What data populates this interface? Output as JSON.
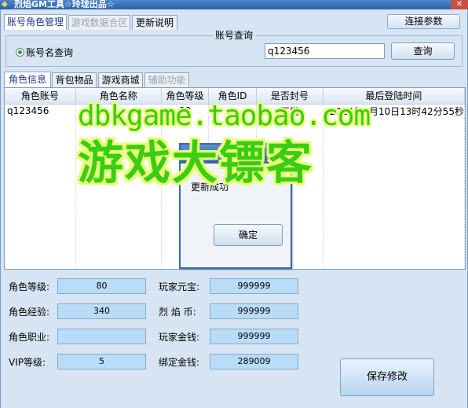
{
  "window": {
    "title": "烈焰GM工具☆玲珑出品☆",
    "close_glyph": "✕"
  },
  "top_tabs": [
    {
      "label": "账号角色管理",
      "state": "active"
    },
    {
      "label": "游戏数据合区",
      "state": "disabled"
    },
    {
      "label": "更新说明",
      "state": "normal"
    }
  ],
  "connect_button": "连接参数",
  "account_query": {
    "group_title": "账号查询",
    "radio_label": "账号名查询",
    "input_value": "q123456",
    "search_button": "查询"
  },
  "content_tabs": [
    {
      "label": "角色信息",
      "state": "active"
    },
    {
      "label": "背包物品",
      "state": "normal"
    },
    {
      "label": "游戏商城",
      "state": "normal"
    },
    {
      "label": "辅助功能",
      "state": "disabled"
    }
  ],
  "table": {
    "columns": [
      "角色账号",
      "角色名称",
      "角色等级",
      "角色ID",
      "是否封号",
      "最后登陆时间"
    ],
    "rows": [
      [
        "q123456",
        "",
        "80",
        "",
        "正常",
        "2014年5月10日13时42分55秒"
      ]
    ]
  },
  "dialog": {
    "title": "信息",
    "message": "更新成功",
    "ok_button": "确定"
  },
  "watermark": {
    "line1": "dbkgame.taobao.com",
    "line2": "游戏大镖客"
  },
  "fields": {
    "level": {
      "label": "角色等级:",
      "value": "80"
    },
    "exp": {
      "label": "角色经验:",
      "value": "340"
    },
    "job": {
      "label": "角色职业:",
      "value": ""
    },
    "vip": {
      "label": "VIP等级:",
      "value": "5"
    },
    "yuanbao": {
      "label": "玩家元宝:",
      "value": "999999"
    },
    "flame_coin": {
      "label": "烈 焰 币:",
      "value": "999999"
    },
    "gold": {
      "label": "玩家金钱:",
      "value": "999999"
    },
    "bound_gold": {
      "label": "绑定金钱:",
      "value": "289009"
    }
  },
  "save_button": "保存修改",
  "colors": {
    "accent": "#2e66aa",
    "field_bg": "#b9dcf9",
    "watermark": "#3bcc14"
  }
}
